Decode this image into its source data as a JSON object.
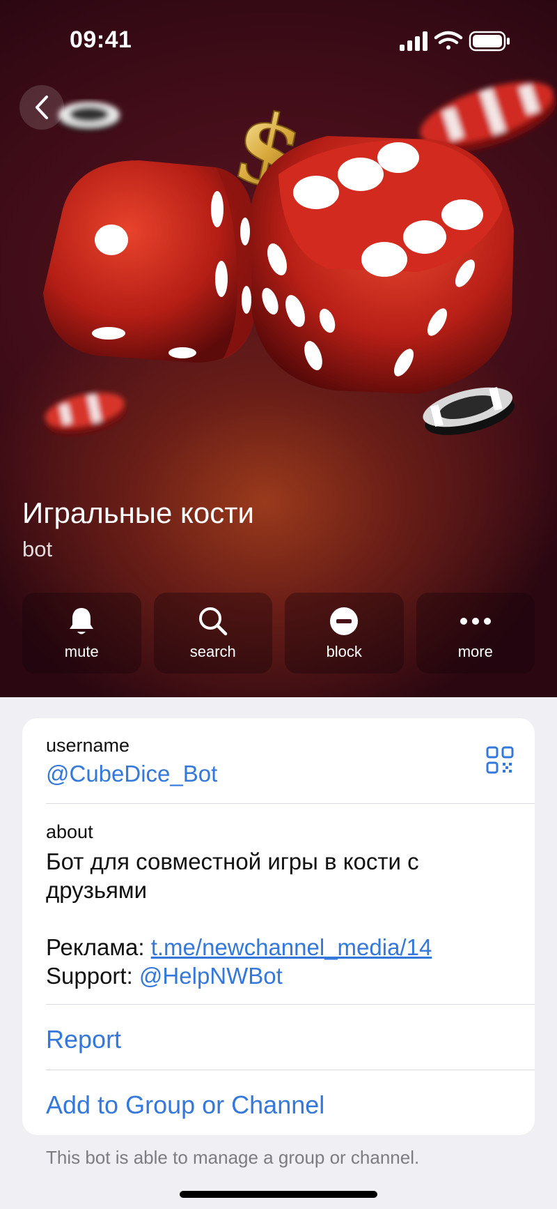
{
  "status": {
    "time": "09:41"
  },
  "profile": {
    "name": "Игральные кости",
    "subtitle": "bot"
  },
  "actions": [
    {
      "icon": "bell-icon",
      "label": "mute"
    },
    {
      "icon": "search-icon",
      "label": "search"
    },
    {
      "icon": "block-icon",
      "label": "block"
    },
    {
      "icon": "more-icon",
      "label": "more"
    }
  ],
  "info": {
    "username_label": "username",
    "username_value": "@CubeDice_Bot",
    "about_label": "about",
    "about_text": "Бот для совместной игры в кости с друзьями",
    "ad_label": "Реклама:",
    "ad_link": "t.me/newchannel_media/14",
    "support_label": "Support:",
    "support_link": "@HelpNWBot"
  },
  "menu": {
    "report": "Report",
    "add_to_group": "Add to Group or Channel"
  },
  "footnote": "This bot is able to manage a group or channel.",
  "colors": {
    "accent": "#3478dc",
    "hero_dark": "#3a0b16",
    "dice_red": "#c8281c"
  }
}
